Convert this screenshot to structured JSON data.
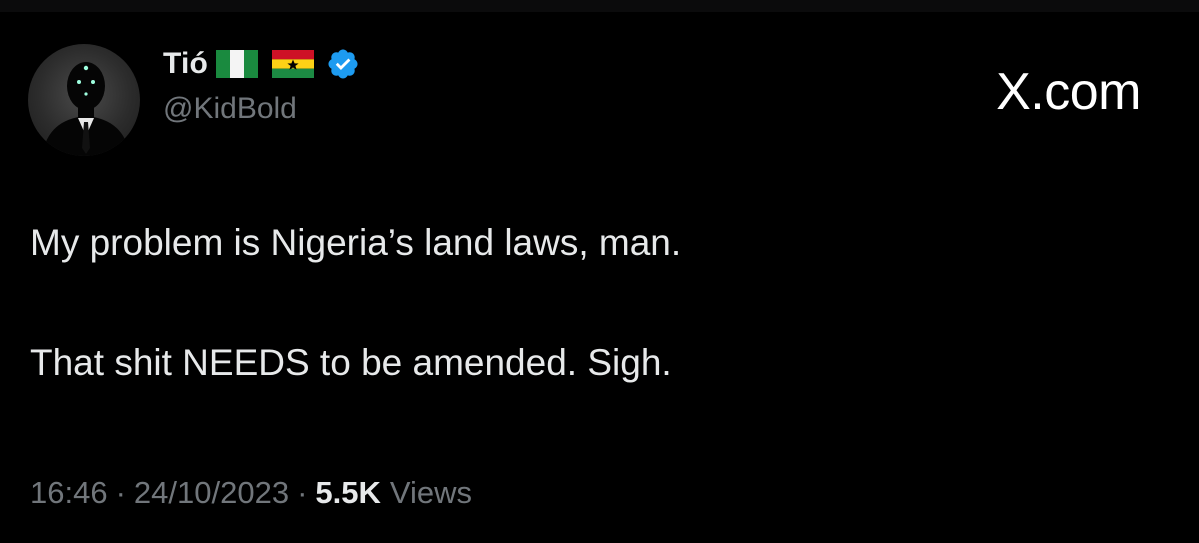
{
  "tweet": {
    "author": {
      "display_name": "Tió",
      "handle": "@KidBold",
      "flags": [
        "nigeria-flag",
        "ghana-flag"
      ],
      "verified": true
    },
    "brand": "X.com",
    "lines": [
      "My problem is Nigeria’s land laws, man.",
      "That shit NEEDS to be amended. Sigh."
    ],
    "meta": {
      "time": "16:46",
      "separator": "·",
      "date": "24/10/2023",
      "views_count": "5.5K",
      "views_label": "Views"
    }
  },
  "colors": {
    "background": "#000000",
    "text_primary": "#e7e9ea",
    "text_secondary": "#71767b",
    "verified_blue": "#1d9bf0"
  }
}
